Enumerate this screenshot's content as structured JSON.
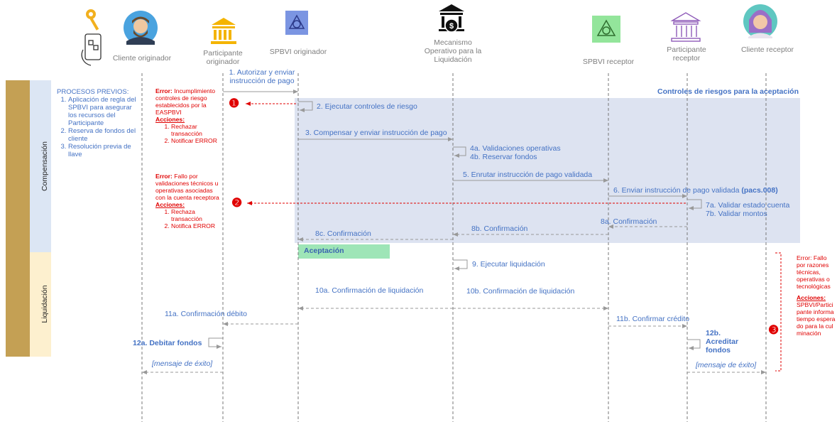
{
  "participants": {
    "cliente_originador": "Cliente originador",
    "participante_originador": "Participante originador",
    "spbvi_originador": "SPBVI originador",
    "mecanismo": "Mecanismo Operativo para la Liquidación",
    "spbvi_receptor": "SPBVI receptor",
    "participante_receptor": "Participante receptor",
    "cliente_receptor": "Cliente receptor"
  },
  "phases": {
    "compensacion": "Compensación",
    "liquidacion": "Liquidación"
  },
  "procesos_previos": {
    "title": "PROCESOS PREVIOS:",
    "items": [
      "Aplicación de regla del SPBVI para asegurar los recursos del Participante",
      "Reserva de fondos del cliente",
      "Resolución previa de llave"
    ]
  },
  "region_title": "Controles de riesgos para la aceptación",
  "aceptacion": "Aceptación",
  "errors": {
    "e1": {
      "marker": "❶",
      "label": "Error:",
      "text": "Incumplimiento controles de riesgo establecidos por la EASPBVI",
      "acciones": "Acciones:",
      "items": [
        "Rechazar transacción",
        "Notificar ERROR"
      ]
    },
    "e2": {
      "marker": "❷",
      "label": "Error:",
      "text": "Fallo por validaciones técnicos u operativas asociadas con la cuenta receptora",
      "acciones": "Acciones:",
      "items": [
        "Rechaza transacción",
        "Notifica ERROR"
      ]
    },
    "e3": {
      "marker": "❸",
      "text": "Error: Fallo por razones técnicas, operativas o tecnológicas",
      "acciones": "Acciones:",
      "body": "SPBVI/Participante informa tiempo esperado para la culminación"
    }
  },
  "steps": {
    "s1": "1. Autorizar y enviar instrucción de pago",
    "s2": "2. Ejecutar controles de riesgo",
    "s3": "3. Compensar y enviar instrucción de pago",
    "s4a": "4a. Validaciones operativas",
    "s4b": "4b. Reservar fondos",
    "s5": "5. Enrutar instrucción de pago validada",
    "s6": "6. Enviar instrucción de pago validada",
    "s6b": "(pacs.008)",
    "s7a": "7a. Validar estado cuenta",
    "s7b": "7b. Validar montos",
    "s8a": "8a. Confirmación",
    "s8b": "8b. Confirmación",
    "s8c": "8c. Confirmación",
    "s9": "9. Ejecutar liquidación",
    "s10a": "10a. Confirmación de liquidación",
    "s10b": "10b. Confirmación de liquidación",
    "s11a": "11a. Confirmación débito",
    "s11b": "11b. Confirmar crédito",
    "s12a": "12a. Debitar fondos",
    "s12b": "12b. Acreditar fondos",
    "exito_a": "[mensaje de éxito]",
    "exito_b": "[mensaje de éxito]"
  },
  "colors": {
    "accent_blue": "#4472c4",
    "region_fill": "#dde3f1",
    "compensacion_fill": "#dce6f4",
    "liquidacion_fill": "#fdf0cf",
    "phase_bar": "#c4a054",
    "aceptacion_fill": "#9ee5b7",
    "error_red": "#e00000"
  }
}
